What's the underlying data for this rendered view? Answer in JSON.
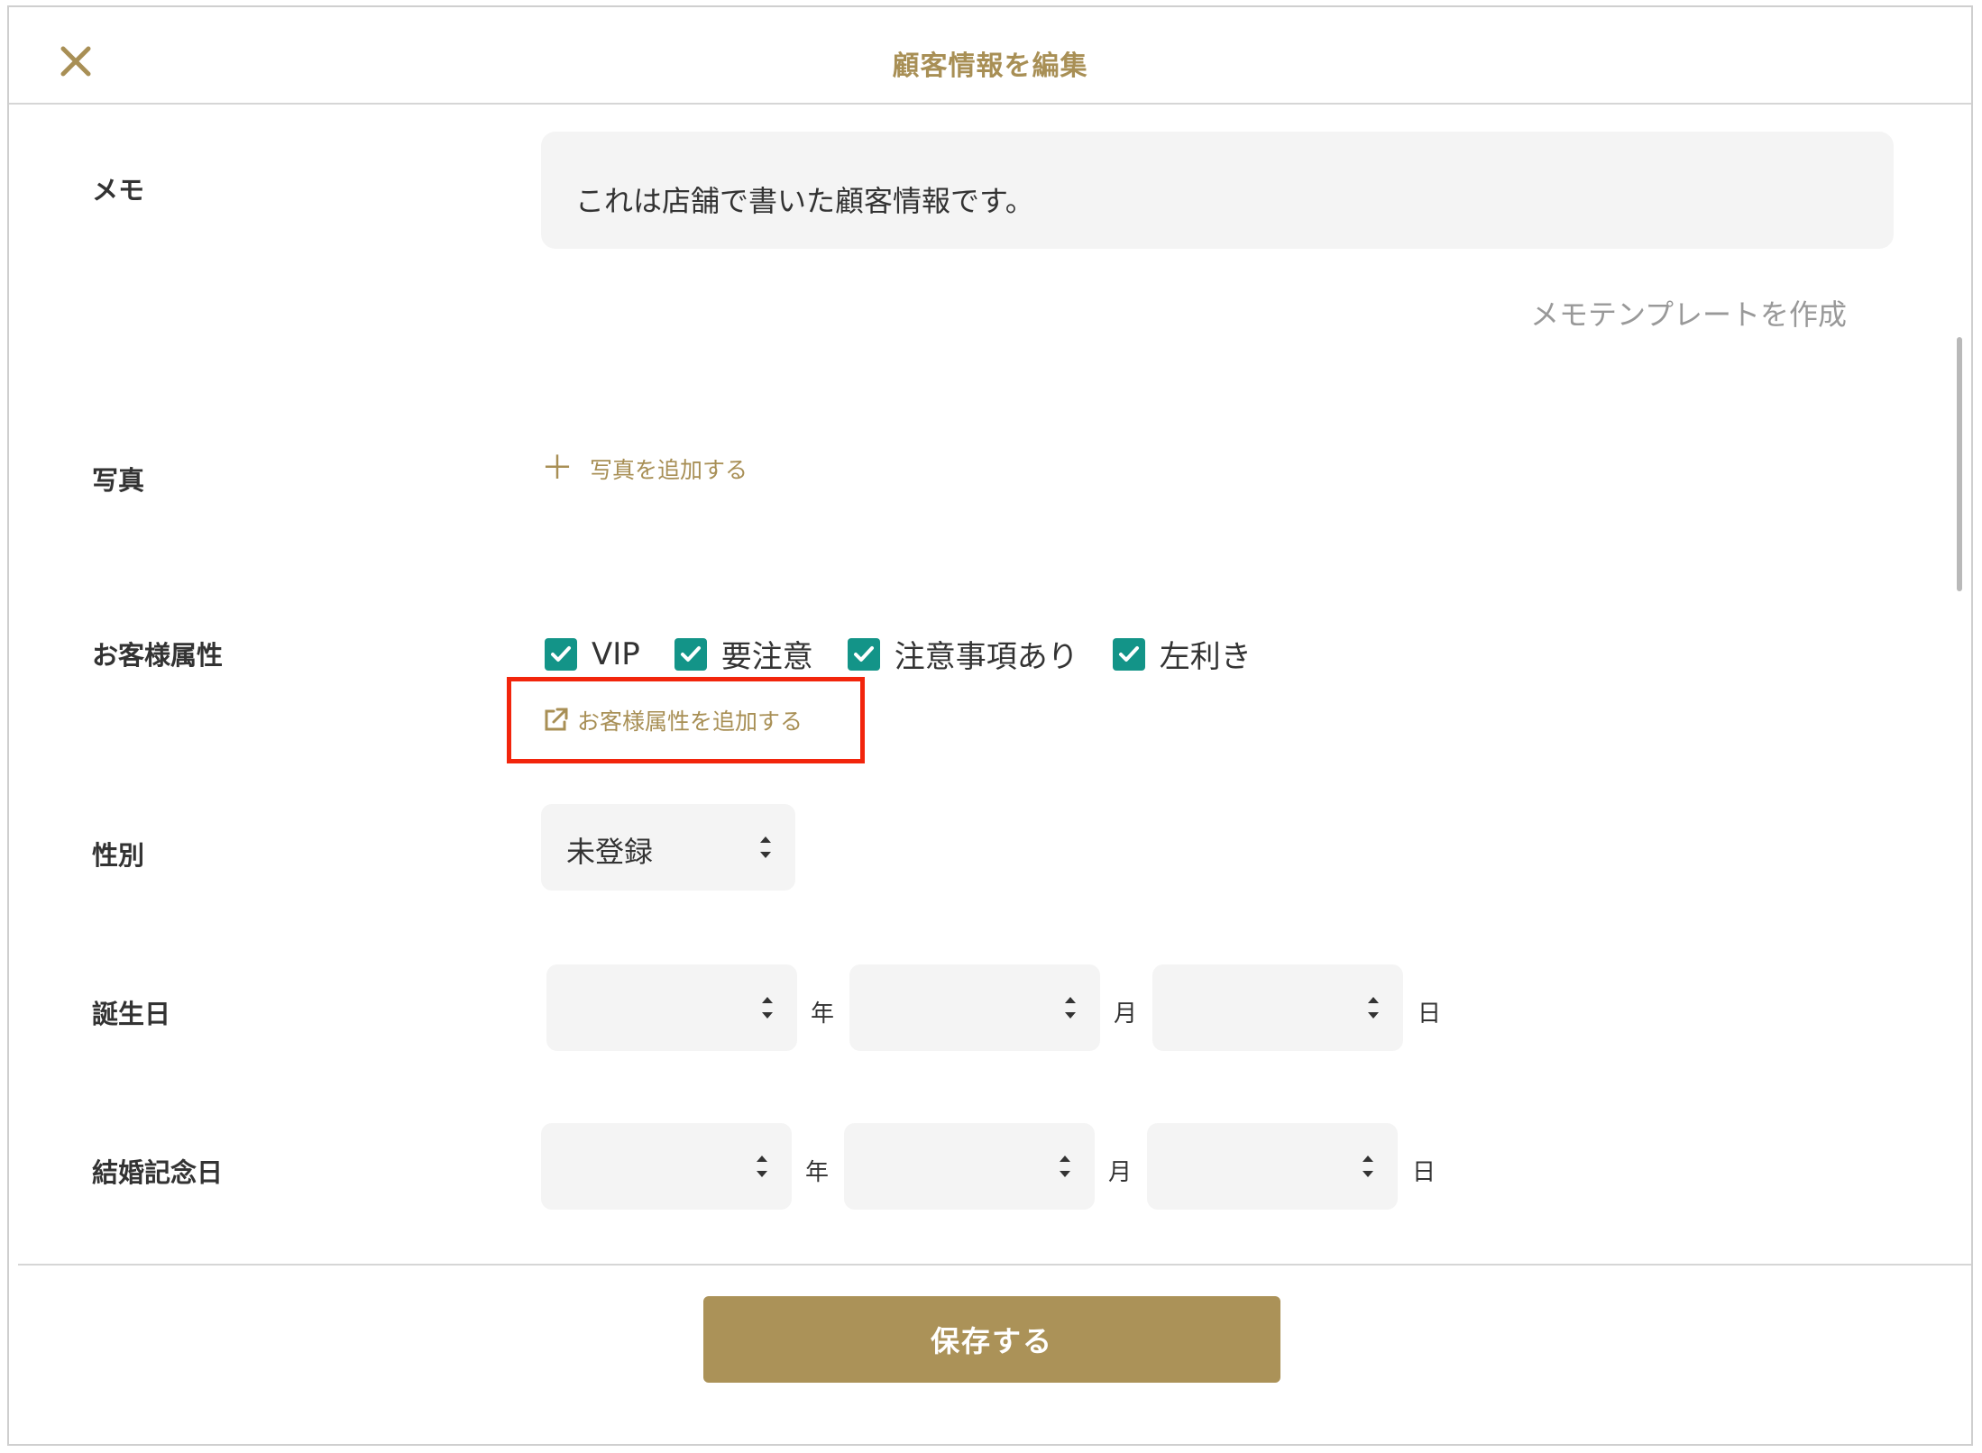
{
  "header": {
    "title": "顧客情報を編集",
    "close_icon": "close-icon"
  },
  "memo": {
    "label": "メモ",
    "value": "これは店舗で書いた顧客情報です。",
    "template_link": "メモテンプレートを作成"
  },
  "photo": {
    "label": "写真",
    "add_label": "写真を追加する"
  },
  "attributes": {
    "label": "お客様属性",
    "items": [
      {
        "label": "VIP",
        "checked": true
      },
      {
        "label": "要注意",
        "checked": true
      },
      {
        "label": "注意事項あり",
        "checked": true
      },
      {
        "label": "左利き",
        "checked": true
      }
    ],
    "add_label": "お客様属性を追加する"
  },
  "gender": {
    "label": "性別",
    "value": "未登録"
  },
  "birthday": {
    "label": "誕生日",
    "year": "",
    "month": "",
    "day": "",
    "year_unit": "年",
    "month_unit": "月",
    "day_unit": "日"
  },
  "anniversary": {
    "label": "結婚記念日",
    "year": "",
    "month": "",
    "day": "",
    "year_unit": "年",
    "month_unit": "月",
    "day_unit": "日"
  },
  "footer": {
    "save_label": "保存する"
  },
  "colors": {
    "accent": "#a88f55",
    "check": "#139488",
    "highlight": "#f2250c",
    "save_bg": "#ab9258"
  }
}
